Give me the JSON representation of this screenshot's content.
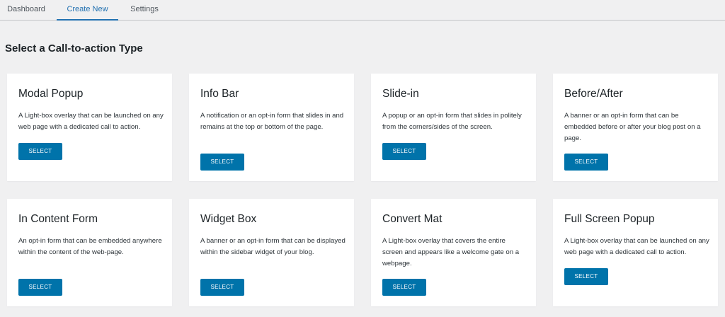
{
  "tabs": [
    {
      "label": "Dashboard"
    },
    {
      "label": "Create New",
      "active": true
    },
    {
      "label": "Settings"
    }
  ],
  "page_title": "Select a Call-to-action Type",
  "cards": [
    {
      "title": "Modal Popup",
      "description": "A Light-box overlay that can be launched on any web page with a dedicated call to action.",
      "button_label": "SELECT"
    },
    {
      "title": "Info Bar",
      "description": "A notification or an opt-in form that slides in and remains at the top or bottom of the page.",
      "button_label": "SELECT"
    },
    {
      "title": "Slide-in",
      "description": "A popup or an opt-in form that slides in politely from the corners/sides of the screen.",
      "button_label": "SELECT"
    },
    {
      "title": "Before/After",
      "description": "A banner or an opt-in form that can be embedded before or after your blog post on a page.",
      "button_label": "SELECT"
    },
    {
      "title": "In Content Form",
      "description": "An opt-in form that can be embedded anywhere within the content of the web-page.",
      "button_label": "SELECT"
    },
    {
      "title": "Widget Box",
      "description": "A banner or an opt-in form that can be displayed within the sidebar widget of your blog.",
      "button_label": "SELECT"
    },
    {
      "title": "Convert Mat",
      "description": "A Light-box overlay that covers the entire screen and appears like a welcome gate on a webpage.",
      "button_label": "SELECT"
    },
    {
      "title": "Full Screen Popup",
      "description": "A Light-box overlay that can be launched on any web page with a dedicated call to action.",
      "button_label": "SELECT"
    }
  ],
  "colors": {
    "accent": "#2271b1",
    "button": "#0073aa",
    "background": "#f0f0f1"
  }
}
